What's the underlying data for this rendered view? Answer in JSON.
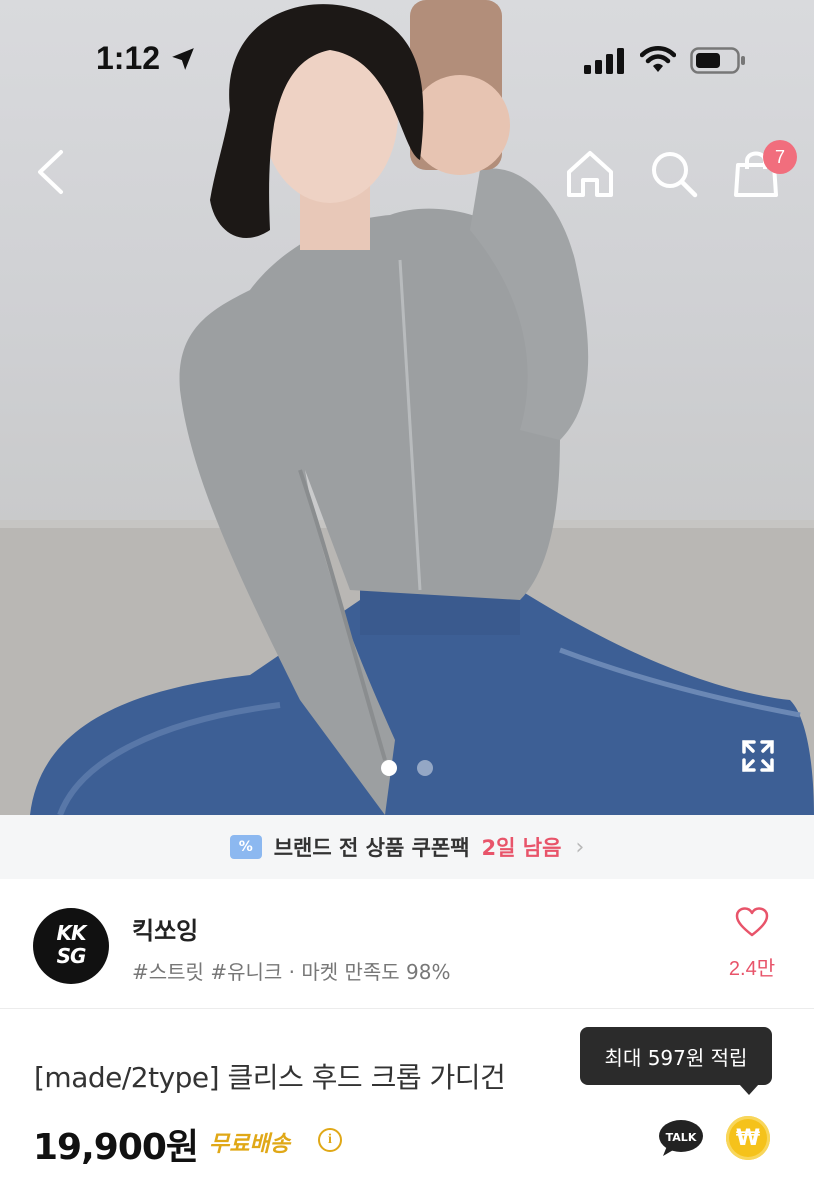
{
  "status_bar": {
    "time": "1:12"
  },
  "nav": {
    "cart_count": "7"
  },
  "gallery": {
    "total_images": 2,
    "active_index": 0
  },
  "coupon_banner": {
    "icon_text": "%",
    "text": "브랜드 전 상품 쿠폰팩",
    "days_left": "2일 남음",
    "chevron": "›"
  },
  "shop": {
    "logo_line1": "KK",
    "logo_line2": "SG",
    "name": "킥쏘잉",
    "tags": "#스트릿 #유니크 · 마켓 만족도 98%",
    "like_count": "2.4만"
  },
  "product": {
    "title": "[made/2type] 클리스 후드 크롭 가디건",
    "price": "19,900원",
    "shipping": "무료배송",
    "info_icon": "i",
    "points_tooltip": "최대 597원 적립",
    "talk_label": "TALK",
    "won_symbol": "₩"
  },
  "colors": {
    "accent_red": "#e8546a",
    "badge_red": "#f16e7d",
    "shipping_gold": "#e0a817",
    "coin_yellow": "#f5c21b",
    "tooltip_bg": "#2b2b2b",
    "coupon_bg": "#f5f6f7"
  },
  "icons": [
    "back-arrow-icon",
    "home-icon",
    "search-icon",
    "cart-icon",
    "expand-icon",
    "heart-icon",
    "talk-icon",
    "won-coin-icon",
    "coupon-icon",
    "info-icon"
  ]
}
